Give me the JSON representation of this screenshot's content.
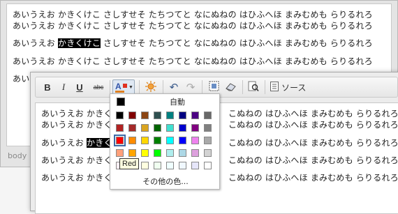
{
  "background_editor": {
    "lines": [
      "あいうえお かきくけこ さしすせそ たちつてと なにぬねの はひふへほ まみむめも らりるれろ",
      "あいうえお かきくけこ さしすせそ たちつてと なにぬねの はひふへほ まみむめも らりるれろ",
      "さしすせそ たちつてと なにぬねの はひふへほ まみむめも らりるれろ",
      "あいうえお かきくけこ さしすせそ たちつてと なにぬねの はひふへほ まみむめも らりるれろ",
      "あいうえお"
    ],
    "line3_prefix": "あいうえお ",
    "line3_highlight": "かきくけこ",
    "status": "body"
  },
  "toolbar": {
    "bold": "B",
    "italic": "I",
    "underline": "U",
    "strike": "abc",
    "source_label": "ソース"
  },
  "editor": {
    "lines": [
      {
        "before": "あいうえお かきくけこ",
        "after": "こぬねの はひふへほ まみむめも らりるれろ"
      },
      {
        "before": "あいうえお かきくけこ",
        "after": "こぬねの はひふへほ まみむめも らりるれろ"
      },
      {
        "before": "あいうえお ",
        "highlight": "かきくけこ",
        "after": "こぬねの はひふへほ まみむめも らりるれろ"
      },
      {
        "before": "あいうえお かきくけこ",
        "after": "こぬねの はひふへほ まみむめも らりるれろ"
      },
      {
        "before": "あいうえお かきくけこ",
        "after": "こぬねの はひふへほ まみむめも らりるれろ"
      }
    ]
  },
  "color_panel": {
    "auto_label": "自動",
    "more_label": "その他の色...",
    "selected": "#ff0000",
    "tooltip": "Red",
    "colors": [
      [
        "#000000",
        "#800000",
        "#8b4513",
        "#2f4f4f",
        "#008080",
        "#000080",
        "#4b0082",
        "#696969"
      ],
      [
        "#b22222",
        "#a52a2a",
        "#daa520",
        "#006400",
        "#40e0d0",
        "#0000cd",
        "#800080",
        "#808080"
      ],
      [
        "#ff0000",
        "#ff8c00",
        "#ffd700",
        "#008000",
        "#00ffff",
        "#0000ff",
        "#ee82ee",
        "#a9a9a9"
      ],
      [
        "#ffa07a",
        "#ffa500",
        "#ffff00",
        "#00ff00",
        "#afeeee",
        "#add8e6",
        "#dda0dd",
        "#d3d3d3"
      ],
      [
        "#fff0f5",
        "#faebd7",
        "#ffffe0",
        "#f0fff0",
        "#f0ffff",
        "#f0f8ff",
        "#e6e6fa",
        "#ffffff"
      ]
    ]
  }
}
